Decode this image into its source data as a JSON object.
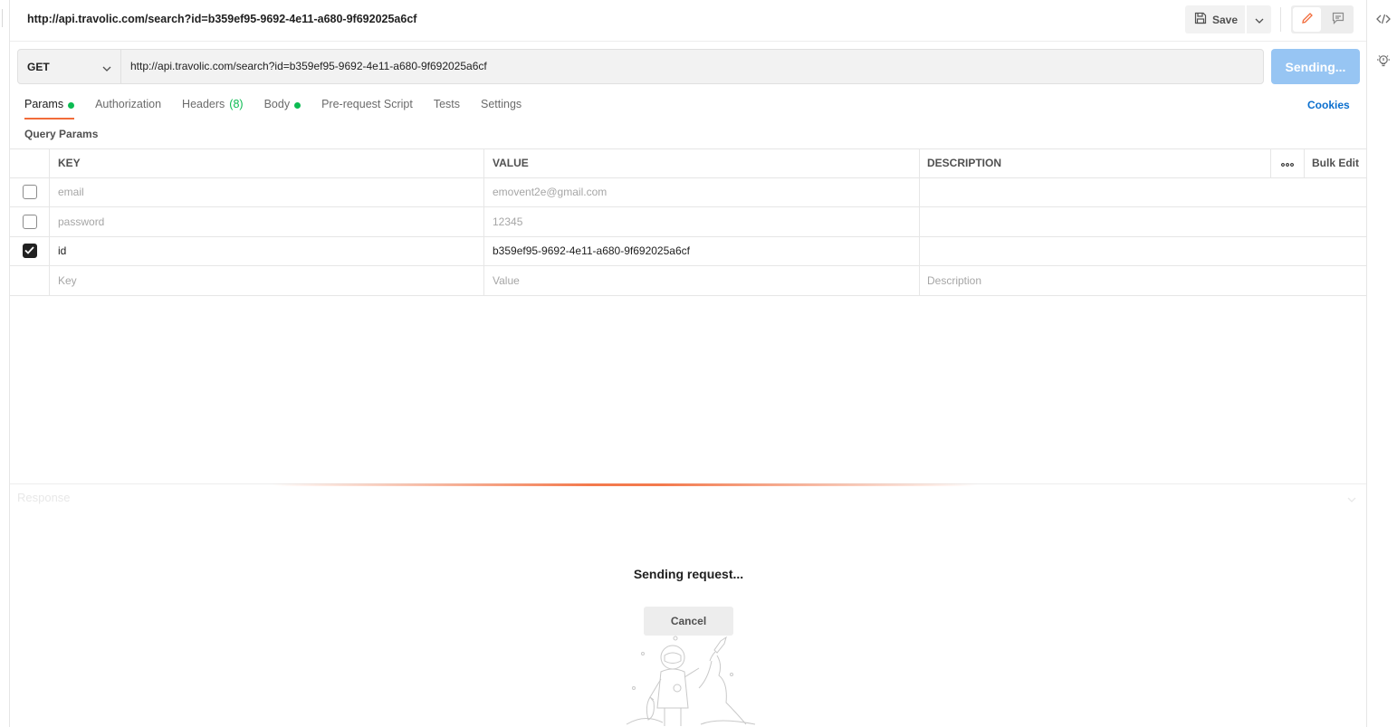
{
  "header": {
    "title": "http://api.travolic.com/search?id=b359ef95-9692-4e11-a680-9f692025a6cf",
    "save_label": "Save"
  },
  "request": {
    "method": "GET",
    "url": "http://api.travolic.com/search?id=b359ef95-9692-4e11-a680-9f692025a6cf",
    "send_label": "Sending..."
  },
  "tabs": [
    {
      "label": "Params",
      "dot": true,
      "active": true
    },
    {
      "label": "Authorization"
    },
    {
      "label": "Headers",
      "count": "(8)"
    },
    {
      "label": "Body",
      "dot": true
    },
    {
      "label": "Pre-request Script"
    },
    {
      "label": "Tests"
    },
    {
      "label": "Settings"
    }
  ],
  "cookies_label": "Cookies",
  "query_params": {
    "title": "Query Params",
    "headers": {
      "key": "KEY",
      "value": "VALUE",
      "description": "DESCRIPTION",
      "bulk_edit": "Bulk Edit"
    },
    "rows": [
      {
        "checked": false,
        "key": "email",
        "value": "emovent2e@gmail.com",
        "description": ""
      },
      {
        "checked": false,
        "key": "password",
        "value": "12345",
        "description": ""
      },
      {
        "checked": true,
        "key": "id",
        "value": "b359ef95-9692-4e11-a680-9f692025a6cf",
        "description": ""
      }
    ],
    "placeholder": {
      "key": "Key",
      "value": "Value",
      "description": "Description"
    }
  },
  "response": {
    "label": "Response",
    "status_text": "Sending request...",
    "cancel_label": "Cancel"
  },
  "colors": {
    "accent": "#f26b3a",
    "send_button": "#97c5f3",
    "link": "#0b6fce",
    "dot": "#0cbb52"
  }
}
